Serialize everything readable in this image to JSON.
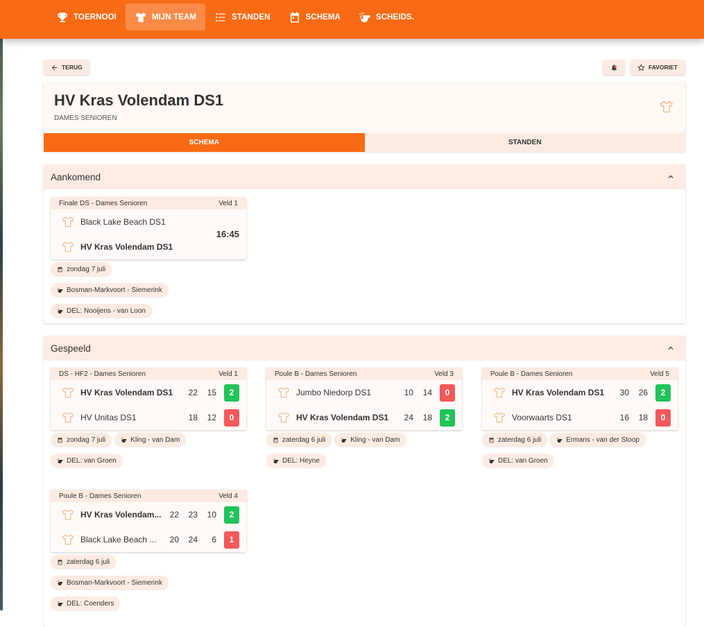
{
  "nav": {
    "items": [
      {
        "label": "TOERNOOI",
        "icon": "trophy-icon"
      },
      {
        "label": "MIJN TEAM",
        "icon": "shirt-icon",
        "active": true
      },
      {
        "label": "STANDEN",
        "icon": "list-icon"
      },
      {
        "label": "SCHEMA",
        "icon": "calendar-icon"
      },
      {
        "label": "SCHEIDS.",
        "icon": "whistle-icon"
      }
    ]
  },
  "toolbar": {
    "back_label": "TERUG",
    "favorite_label": "FAVORIET",
    "notify_icon": "bell-off-icon"
  },
  "team": {
    "name": "HV Kras Volendam DS1",
    "category": "DAMES SENIOREN"
  },
  "tabs": [
    {
      "label": "SCHEMA",
      "active": true
    },
    {
      "label": "STANDEN",
      "active": false
    }
  ],
  "upcoming": {
    "title": "Aankomend",
    "matches": [
      {
        "round": "Finale DS - Dames Senioren",
        "field": "Veld 1",
        "home": "Black Lake Beach DS1",
        "away": "HV Kras Volendam DS1",
        "time": "16:45",
        "date": "zondag 7 juli",
        "referees": "Bosman-Markvoort - Siemerink",
        "delegate": "DEL: Nooijens - van Loon"
      }
    ]
  },
  "played": {
    "title": "Gespeeld",
    "matches": [
      {
        "round": "DS - HF2 - Dames Senioren",
        "field": "Veld 1",
        "teams": [
          {
            "name": "HV Kras Volendam DS1",
            "bold": true,
            "s1": "22",
            "s2": "15",
            "s3": "",
            "points": "2",
            "result": "win"
          },
          {
            "name": "HV Unitas DS1",
            "bold": false,
            "s1": "18",
            "s2": "12",
            "s3": "",
            "points": "0",
            "result": "loss"
          }
        ],
        "date": "zondag 7 juli",
        "referees": "Kling - van Dam",
        "delegate": "DEL: van Groen"
      },
      {
        "round": "Poule B - Dames Senioren",
        "field": "Veld 3",
        "teams": [
          {
            "name": "Jumbo Niedorp DS1",
            "bold": false,
            "s1": "10",
            "s2": "14",
            "s3": "",
            "points": "0",
            "result": "loss"
          },
          {
            "name": "HV Kras Volendam DS1",
            "bold": true,
            "s1": "24",
            "s2": "18",
            "s3": "",
            "points": "2",
            "result": "win"
          }
        ],
        "date": "zaterdag 6 juli",
        "referees": "Kling - van Dam",
        "delegate": "DEL: Heyne"
      },
      {
        "round": "Poule B - Dames Senioren",
        "field": "Veld 5",
        "teams": [
          {
            "name": "HV Kras Volendam DS1",
            "bold": true,
            "s1": "30",
            "s2": "26",
            "s3": "",
            "points": "2",
            "result": "win"
          },
          {
            "name": "Voorwaarts DS1",
            "bold": false,
            "s1": "16",
            "s2": "18",
            "s3": "",
            "points": "0",
            "result": "loss"
          }
        ],
        "date": "zaterdag 6 juli",
        "referees": "Ermans - van der Stoop",
        "delegate": "DEL: van Groen"
      },
      {
        "round": "Poule B - Dames Senioren",
        "field": "Veld 4",
        "teams": [
          {
            "name": "HV Kras Volendam...",
            "bold": true,
            "s1": "22",
            "s2": "23",
            "s3": "10",
            "points": "2",
            "result": "win"
          },
          {
            "name": "Black Lake Beach ...",
            "bold": false,
            "s1": "20",
            "s2": "24",
            "s3": "6",
            "points": "1",
            "result": "loss"
          }
        ],
        "date": "zaterdag 6 juli",
        "referees": "Bosman-Markvoort - Siemerink",
        "delegate": "DEL: Coenders"
      }
    ]
  },
  "colors": {
    "brand": "#f96a14",
    "win": "#21c35a",
    "loss": "#f4585b",
    "tint": "#fcebe2"
  }
}
